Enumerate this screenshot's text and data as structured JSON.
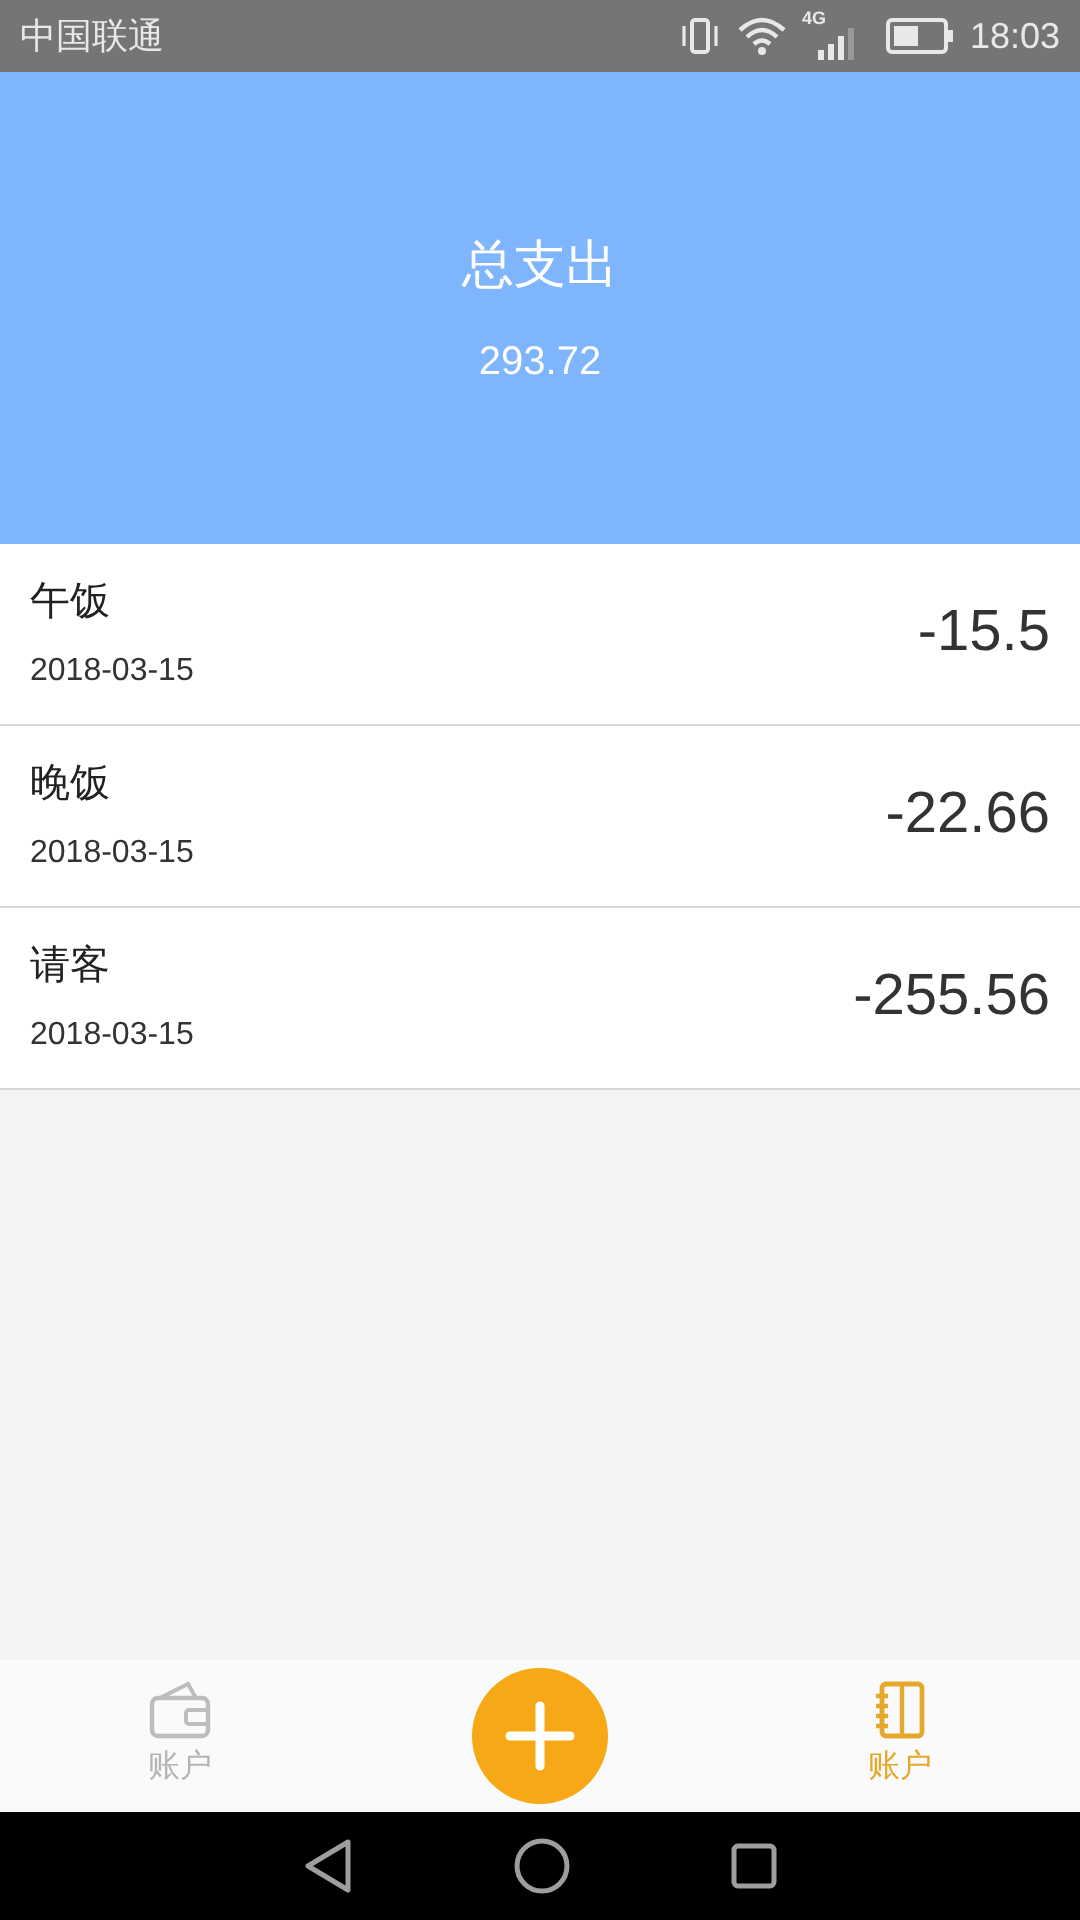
{
  "status_bar": {
    "carrier": "中国联通",
    "network": "4G",
    "time": "18:03"
  },
  "header": {
    "title": "总支出",
    "total": "293.72"
  },
  "records": [
    {
      "name": "午饭",
      "date": "2018-03-15",
      "amount": "-15.5"
    },
    {
      "name": "晚饭",
      "date": "2018-03-15",
      "amount": "-22.66"
    },
    {
      "name": "请客",
      "date": "2018-03-15",
      "amount": "-255.56"
    }
  ],
  "bottom_nav": [
    {
      "kind": "tab",
      "label": "账户",
      "selected": false
    },
    {
      "kind": "add"
    },
    {
      "kind": "tab",
      "label": "账户",
      "selected": true
    }
  ]
}
